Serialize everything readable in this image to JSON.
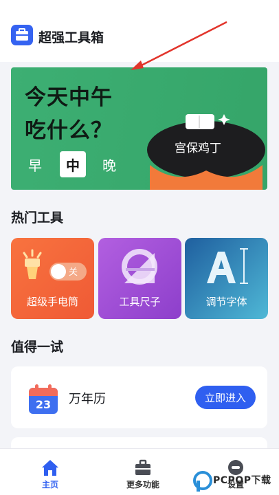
{
  "app": {
    "title": "超强工具箱"
  },
  "banner": {
    "line1": "今天中午",
    "line2": "吃什么？",
    "meals": [
      "早",
      "中",
      "晚"
    ],
    "selected_meal": "中",
    "dish": "宫保鸡丁"
  },
  "hot_tools": {
    "title": "热门工具",
    "items": [
      {
        "label": "超级手电筒",
        "toggle_text": "关"
      },
      {
        "label": "工具尺子"
      },
      {
        "label": "调节字体"
      }
    ]
  },
  "try_section": {
    "title": "值得一试",
    "calendar": {
      "date": "23",
      "title": "万年历",
      "button": "立即进入"
    }
  },
  "tabbar": {
    "items": [
      {
        "label": "主页",
        "icon": "home-icon",
        "active": true
      },
      {
        "label": "更多功能",
        "icon": "toolbox-icon",
        "active": false
      },
      {
        "label": "设置",
        "icon": "settings-icon",
        "active": false
      }
    ]
  },
  "watermark": {
    "text": "PCPOP下载"
  },
  "colors": {
    "accent": "#2f5ff0",
    "banner": "#3daf73",
    "flashlight": "#f2663a",
    "ruler": "#9a4fd6",
    "font": "#3b8fc0"
  }
}
